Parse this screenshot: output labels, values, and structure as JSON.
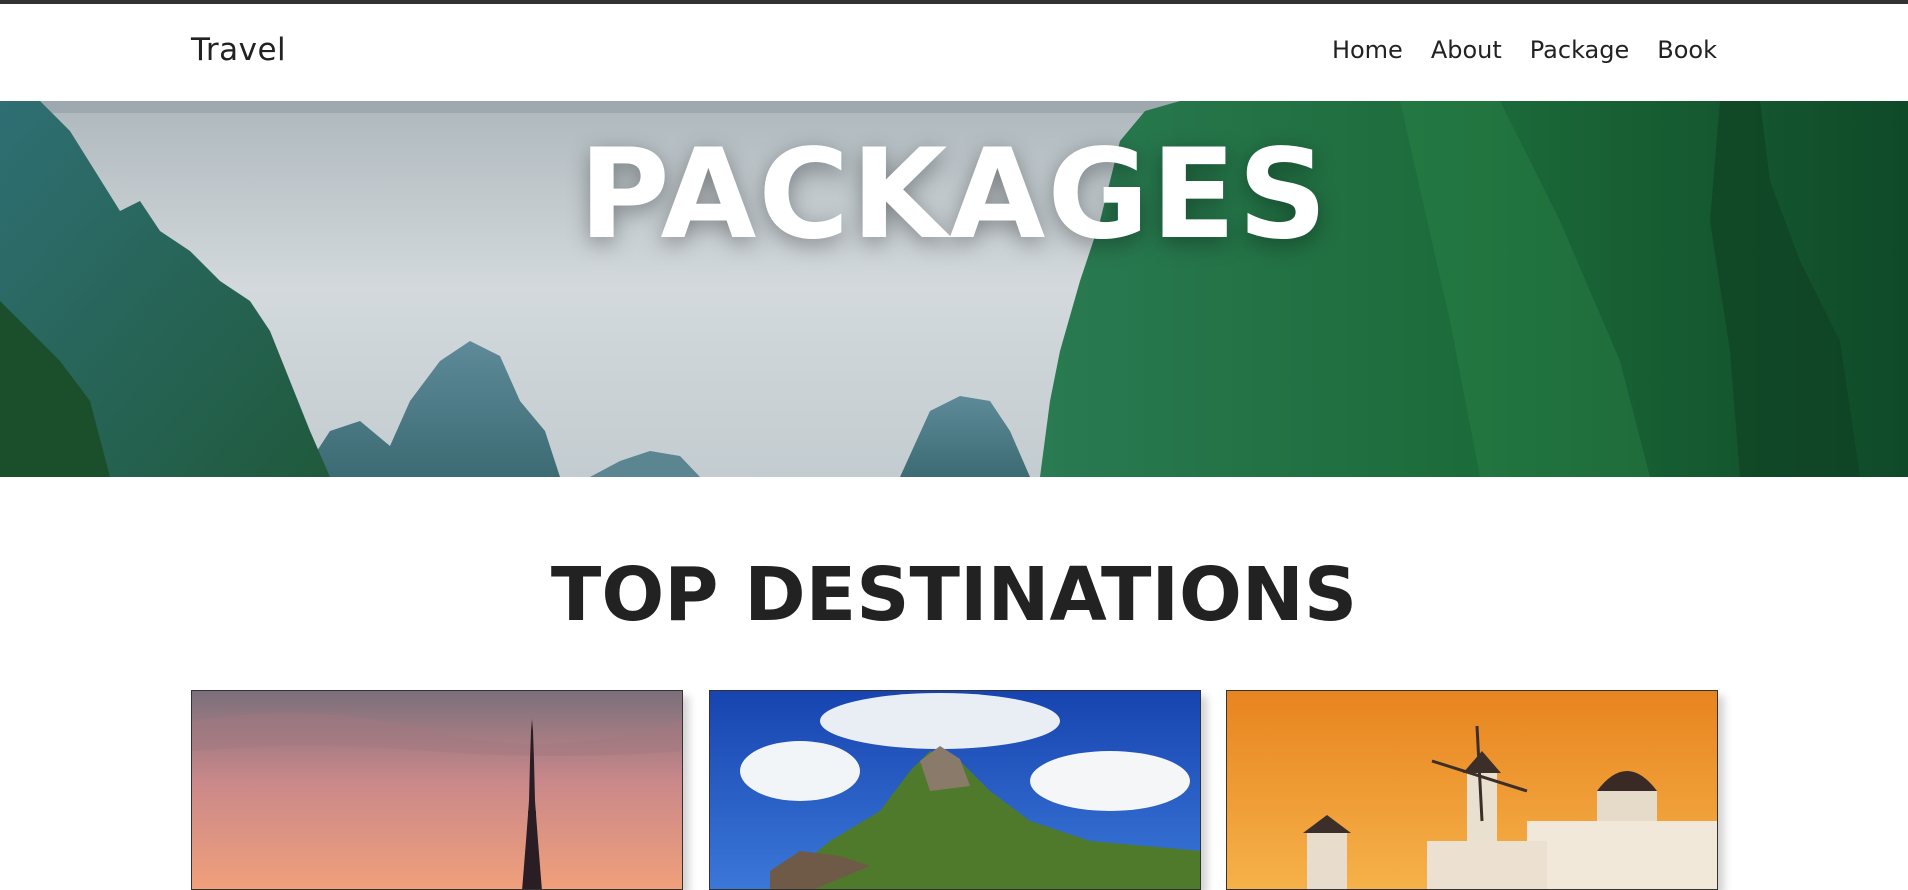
{
  "navbar": {
    "brand": "Travel",
    "links": [
      {
        "label": "Home"
      },
      {
        "label": "About"
      },
      {
        "label": "Package"
      },
      {
        "label": "Book"
      }
    ]
  },
  "hero": {
    "title": "PACKAGES"
  },
  "destinations": {
    "title": "TOP DESTINATIONS"
  },
  "colors": {
    "text": "#222222",
    "top_border": "#333333",
    "hero_title": "#ffffff"
  }
}
